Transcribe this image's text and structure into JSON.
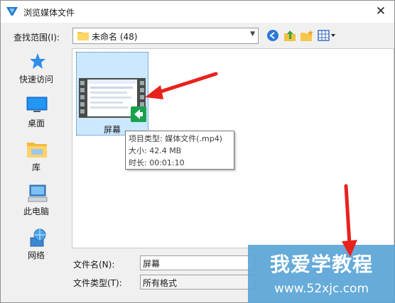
{
  "window": {
    "title": "浏览媒体文件",
    "close_glyph": "✕"
  },
  "lookin": {
    "label": "查找范围(I):",
    "folder": "未命名 (48)"
  },
  "places": [
    {
      "label": "快速访问",
      "icon": "star-icon"
    },
    {
      "label": "桌面",
      "icon": "desktop-icon"
    },
    {
      "label": "库",
      "icon": "library-folder-icon"
    },
    {
      "label": "此电脑",
      "icon": "computer-icon"
    },
    {
      "label": "网络",
      "icon": "network-icon"
    }
  ],
  "file": {
    "name": "屏幕"
  },
  "tooltip": {
    "type": "项目类型: 媒体文件(.mp4)",
    "size": "大小: 42.4 MB",
    "duration": "时长: 00:01:10"
  },
  "filename": {
    "label": "文件名(N):",
    "value": "屏幕"
  },
  "filetype": {
    "label": "文件类型(T):",
    "value": "所有格式"
  },
  "watermark": {
    "title": "我爱学教程",
    "url": "www.52xjc.com"
  },
  "colors": {
    "selection": "#cce8ff",
    "arrow": "#e8221c",
    "watermark": "#5aa5d7"
  }
}
